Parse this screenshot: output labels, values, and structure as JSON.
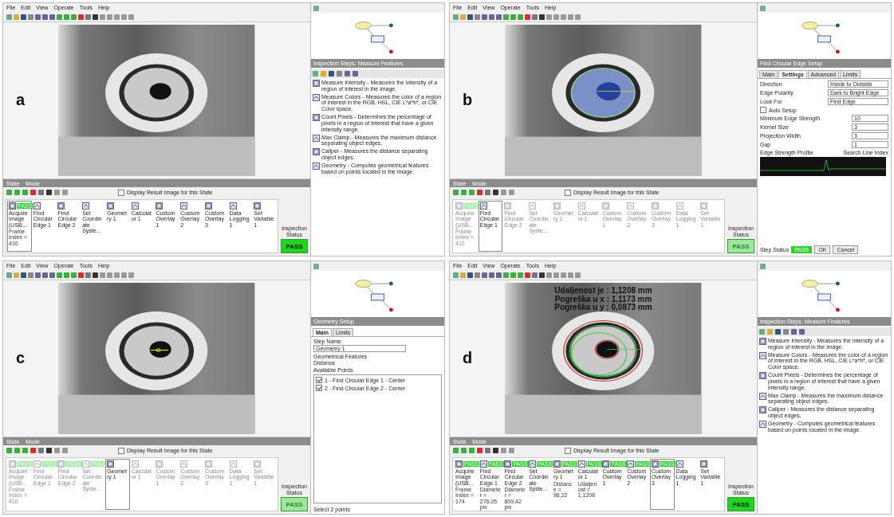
{
  "panels": [
    {
      "label": "a",
      "menu": [
        "File",
        "Edit",
        "View",
        "Operate",
        "Tools",
        "Help"
      ],
      "image": {
        "kind": "plain"
      },
      "bar_tabs": [
        "State",
        "Mode"
      ],
      "display_result": {
        "label": "Display Result Image for this State",
        "checked": false
      },
      "steps": [
        {
          "name": "Acquire Image (USB...",
          "detail": "Frame Index = 410",
          "result": "PASS",
          "disabled": false,
          "selected": true
        },
        {
          "name": "Find Circular Edge 1",
          "disabled": false,
          "selected": false
        },
        {
          "name": "Find Circular Edge 2",
          "disabled": false,
          "selected": false
        },
        {
          "name": "Set Coordinate Syste...",
          "disabled": false,
          "selected": false
        },
        {
          "name": "Geometry 1",
          "disabled": false,
          "selected": false
        },
        {
          "name": "Calculator 1",
          "disabled": false,
          "selected": false
        },
        {
          "name": "Custom Overlay 1",
          "disabled": false,
          "selected": false
        },
        {
          "name": "Custom Overlay 2",
          "disabled": false,
          "selected": false
        },
        {
          "name": "Custom Overlay 3",
          "disabled": false,
          "selected": false
        },
        {
          "name": "Data Logging 1",
          "disabled": false,
          "selected": false
        },
        {
          "name": "Set Variable 1",
          "disabled": false,
          "selected": false
        }
      ],
      "status": {
        "label": "Inspection Status",
        "value": "PASS",
        "faded": false
      },
      "side": {
        "kind": "features",
        "title": "Inspection Steps: Measure Features",
        "items": [
          "Measure Intensity - Measures the intensity of a region of interest in the image.",
          "Measure Colors - Measures the color of a region of interest in the RGB, HSL, CIE L*a*b*, or CIE Color space.",
          "Count Pixels - Determines the percentage of pixels in a region of interest that have a given intensity range.",
          "Max Clamp - Measures the maximum distance separating object edges.",
          "Caliper - Measures the distance separating object edges.",
          "Geometry - Computes geometrical features based on points located in the image."
        ]
      }
    },
    {
      "label": "b",
      "menu": [
        "File",
        "Edit",
        "View",
        "Operate",
        "Tools",
        "Help"
      ],
      "image": {
        "kind": "rake"
      },
      "bar_tabs": [
        "State",
        "Mode"
      ],
      "display_result": {
        "label": "Display Result Image for this State",
        "checked": false
      },
      "steps": [
        {
          "name": "Acquire Image (USB...",
          "detail": "Frame Index = 410",
          "result": "PASS",
          "disabled": true,
          "selected": false
        },
        {
          "name": "Find Circular Edge 1",
          "disabled": false,
          "selected": true
        },
        {
          "name": "Find Circular Edge 2",
          "disabled": true,
          "selected": false
        },
        {
          "name": "Set Coordinate Syste...",
          "disabled": true,
          "selected": false
        },
        {
          "name": "Geometry 1",
          "disabled": true,
          "selected": false
        },
        {
          "name": "Calculator 1",
          "disabled": true,
          "selected": false
        },
        {
          "name": "Custom Overlay 1",
          "disabled": true,
          "selected": false
        },
        {
          "name": "Custom Overlay 2",
          "disabled": true,
          "selected": false
        },
        {
          "name": "Custom Overlay 3",
          "disabled": true,
          "selected": false
        },
        {
          "name": "Data Logging 1",
          "disabled": true,
          "selected": false
        },
        {
          "name": "Set Variable 1",
          "disabled": true,
          "selected": false
        }
      ],
      "status": {
        "label": "Inspection Status",
        "value": "PASS",
        "faded": true
      },
      "side": {
        "kind": "edge_setup",
        "title": "Find Circular Edge Setup",
        "tabs": [
          {
            "label": "Main",
            "selected": false
          },
          {
            "label": "Settings",
            "selected": true
          },
          {
            "label": "Advanced",
            "selected": false
          },
          {
            "label": "Limits",
            "selected": false
          }
        ],
        "selects": [
          {
            "label": "Direction",
            "value": "Inside to Outside"
          },
          {
            "label": "Edge Polarity",
            "value": "Dark to Bright Edge"
          },
          {
            "label": "Look For",
            "value": "First Edge"
          }
        ],
        "auto_setup": {
          "label": "Auto Setup",
          "checked": false
        },
        "numbers": [
          {
            "label": "Minimum Edge Strength",
            "value": "10"
          },
          {
            "label": "Kernel Size",
            "value": "3"
          },
          {
            "label": "Projection Width",
            "value": "3"
          },
          {
            "label": "Gap",
            "value": "1"
          }
        ],
        "profile_title": "Edge Strength Profile",
        "profile_option": "Search Line Index",
        "step_status_label": "Step Status",
        "step_status": "PASS",
        "buttons": [
          "OK",
          "Cancel"
        ]
      }
    },
    {
      "label": "c",
      "menu": [
        "File",
        "Edit",
        "View",
        "Operate",
        "Tools",
        "Help"
      ],
      "image": {
        "kind": "points"
      },
      "bar_tabs": [
        "State",
        "Mode"
      ],
      "display_result": {
        "label": "Display Result Image for this State",
        "checked": false
      },
      "steps": [
        {
          "name": "Acquire Image (USB...",
          "detail": "Frame Index = 410",
          "result": "PASS",
          "disabled": true,
          "selected": false
        },
        {
          "name": "Find Circular Edge 1",
          "result": "PASS",
          "disabled": true,
          "selected": false
        },
        {
          "name": "Find Circular Edge 2",
          "result": "PASS",
          "disabled": true,
          "selected": false
        },
        {
          "name": "Set Coordinate Syste...",
          "result": "PASS",
          "disabled": true,
          "selected": false
        },
        {
          "name": "Geometry 1",
          "disabled": false,
          "selected": true
        },
        {
          "name": "Calculator 1",
          "disabled": true,
          "selected": false
        },
        {
          "name": "Custom Overlay 1",
          "disabled": true,
          "selected": false
        },
        {
          "name": "Custom Overlay 2",
          "disabled": true,
          "selected": false
        },
        {
          "name": "Custom Overlay 3",
          "disabled": true,
          "selected": false
        },
        {
          "name": "Data Logging 1",
          "disabled": true,
          "selected": false
        },
        {
          "name": "Set Variable 1",
          "disabled": true,
          "selected": false
        }
      ],
      "status": {
        "label": "Inspection Status",
        "value": "PASS",
        "faded": true
      },
      "side": {
        "kind": "geometry_setup",
        "title": "Geometry Setup",
        "tabs": [
          {
            "label": "Main",
            "selected": true
          },
          {
            "label": "Limits",
            "selected": false
          }
        ],
        "step_name_label": "Step Name",
        "step_name": "Geometry 1",
        "feature_label": "Geometrical Features",
        "feature": "Distance",
        "points_label": "Available Points",
        "points": [
          {
            "label": "1 - Find Circular Edge 1 - Center",
            "checked": true
          },
          {
            "label": "2 - Find Circular Edge 2 - Center",
            "checked": true
          }
        ],
        "hint": "Select 2 points"
      }
    },
    {
      "label": "d",
      "menu": [
        "File",
        "Edit",
        "View",
        "Operate",
        "Tools",
        "Help"
      ],
      "image": {
        "kind": "circles",
        "overlay_text": [
          "Udaljenost je : 1,1208 mm",
          "Pogreška u x : 1,1173 mm",
          "Pogreška u y : 0,0873 mm"
        ]
      },
      "bar_tabs": [
        "State",
        "Mode"
      ],
      "display_result": {
        "label": "Display Result Image for this State",
        "checked": false
      },
      "steps": [
        {
          "name": "Acquire Image (USB...",
          "detail": "Frame Index = 174",
          "result": "PASS",
          "disabled": false,
          "selected": false
        },
        {
          "name": "Find Circular Edge 1",
          "detail": "Diameter = 276,05 pix",
          "result": "PASS",
          "disabled": false,
          "selected": false
        },
        {
          "name": "Find Circular Edge 2",
          "detail": "Diameter = 809,42 pix",
          "result": "PASS",
          "disabled": false,
          "selected": false
        },
        {
          "name": "Set Coordinate Syste...",
          "result": "PASS",
          "disabled": false,
          "selected": false
        },
        {
          "name": "Geometry 1",
          "detail": "Distance = 96,22",
          "result": "PASS",
          "disabled": false,
          "selected": false
        },
        {
          "name": "Calculator 1",
          "detail": "Udaljenost = 1,1208",
          "result": "PASS",
          "disabled": false,
          "selected": false
        },
        {
          "name": "Custom Overlay 1",
          "result": "PASS",
          "disabled": false,
          "selected": false
        },
        {
          "name": "Custom Overlay 2",
          "result": "PASS",
          "disabled": false,
          "selected": false
        },
        {
          "name": "Custom Overlay 3",
          "result": "PASS",
          "disabled": false,
          "selected": true
        },
        {
          "name": "Data Logging 1",
          "disabled": false,
          "selected": false
        },
        {
          "name": "Set Variable 1",
          "disabled": false,
          "selected": false
        }
      ],
      "status": {
        "label": "Inspection Status",
        "value": "PASS",
        "faded": false
      },
      "side": {
        "kind": "features",
        "title": "Inspection Steps: Measure Features",
        "items": [
          "Measure Intensity - Measures the intensity of a region of interest in the image.",
          "Measure Colors - Measures the color of a region of interest in the RGB, HSL, CIE L*a*b*, or CIE Color space.",
          "Count Pixels - Determines the percentage of pixels in a region of interest that have a given intensity range.",
          "Max Clamp - Measures the maximum distance separating object edges.",
          "Caliper - Measures the distance separating object edges.",
          "Geometry - Computes geometrical features based on points located in the image."
        ]
      }
    }
  ]
}
